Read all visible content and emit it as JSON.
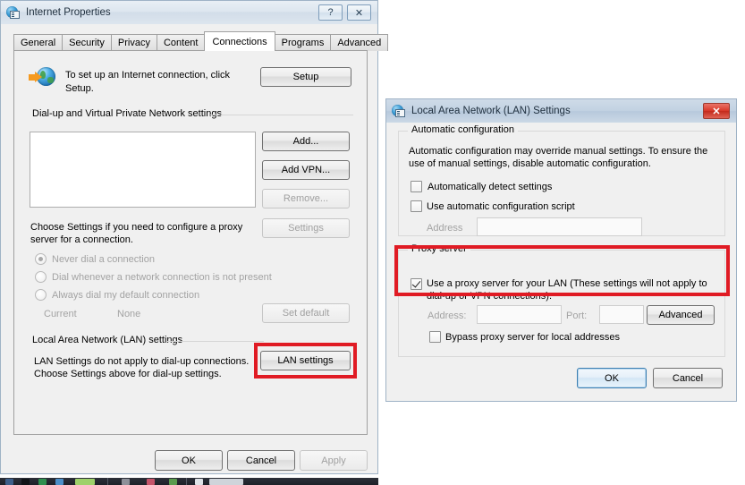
{
  "internet_properties": {
    "title": "Internet Properties",
    "icon": "internet-properties-icon",
    "help_button": "?",
    "close_button": "✕",
    "tabs": [
      {
        "label": "General",
        "selected": false
      },
      {
        "label": "Security",
        "selected": false
      },
      {
        "label": "Privacy",
        "selected": false
      },
      {
        "label": "Content",
        "selected": false
      },
      {
        "label": "Connections",
        "selected": true
      },
      {
        "label": "Programs",
        "selected": false
      },
      {
        "label": "Advanced",
        "selected": false
      }
    ],
    "setup": {
      "text": "To set up an Internet connection, click Setup.",
      "button": "Setup"
    },
    "dialup_group": {
      "label": "Dial-up and Virtual Private Network settings",
      "list_items": [],
      "buttons": [
        {
          "label": "Add...",
          "enabled": true
        },
        {
          "label": "Add VPN...",
          "enabled": true
        },
        {
          "label": "Remove...",
          "enabled": false
        }
      ]
    },
    "choose_settings": {
      "text_line1": "Choose Settings if you need to configure a proxy",
      "text_line2": "server for a connection.",
      "settings_button": "Settings"
    },
    "dial_options": [
      {
        "label": "Never dial a connection",
        "selected": true
      },
      {
        "label": "Dial whenever a network connection is not present",
        "selected": false
      },
      {
        "label": "Always dial my default connection",
        "selected": false
      }
    ],
    "current": {
      "label": "Current",
      "value": "None",
      "set_default_button": "Set default"
    },
    "lan_group": {
      "label": "Local Area Network (LAN) settings",
      "text_line1": "LAN Settings do not apply to dial-up connections.",
      "text_line2": "Choose Settings above for dial-up settings.",
      "button": "LAN settings",
      "highlighted": true
    },
    "footer_buttons": [
      {
        "label": "OK",
        "enabled": true
      },
      {
        "label": "Cancel",
        "enabled": true
      },
      {
        "label": "Apply",
        "enabled": false
      }
    ]
  },
  "lan_settings": {
    "title": "Local Area Network (LAN) Settings",
    "icon": "lan-settings-icon",
    "close_button": "✕",
    "automatic_configuration": {
      "label": "Automatic configuration",
      "description_line1": "Automatic configuration may override manual settings.  To ensure the",
      "description_line2": "use of manual settings, disable automatic configuration.",
      "auto_detect": {
        "label": "Automatically detect settings",
        "checked": false
      },
      "use_script": {
        "label": "Use automatic configuration script",
        "checked": false
      },
      "address_label": "Address",
      "address_value": "",
      "address_enabled": false
    },
    "proxy_server": {
      "label": "Proxy server",
      "use_proxy": {
        "label_line1": "Use a proxy server for your LAN (These settings will not apply to",
        "label_line2": "dial-up or VPN connections).",
        "checked": true
      },
      "highlighted": true,
      "address_label": "Address:",
      "address_value": "",
      "port_label": "Port:",
      "port_value": "",
      "advanced_button": "Advanced",
      "bypass": {
        "label": "Bypass proxy server for local addresses",
        "checked": false
      }
    },
    "footer_buttons": [
      {
        "label": "OK",
        "enabled": true,
        "default": true
      },
      {
        "label": "Cancel",
        "enabled": true,
        "default": false
      }
    ]
  },
  "highlight_color": "#e01b24"
}
